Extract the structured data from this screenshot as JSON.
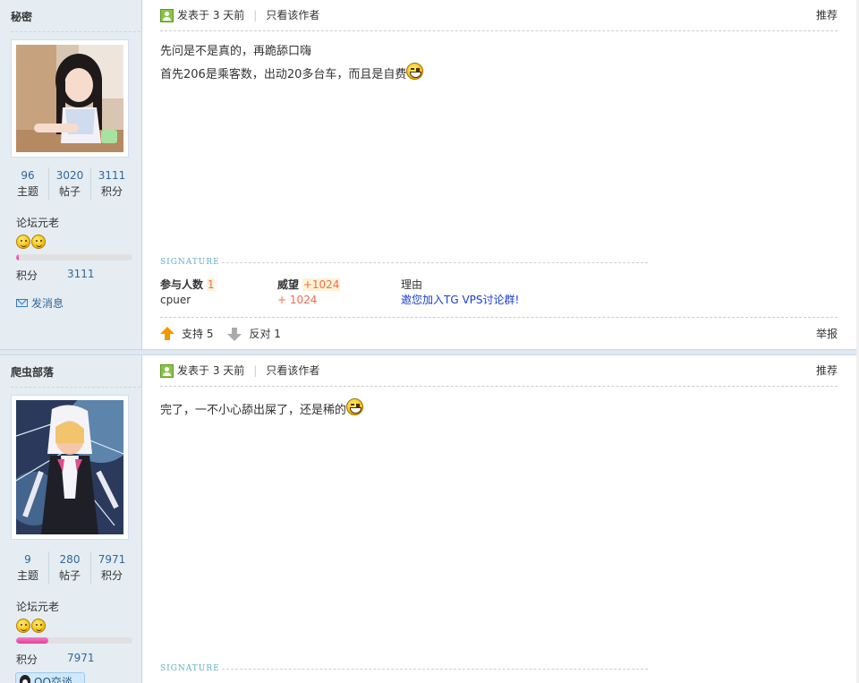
{
  "posts": [
    {
      "author": "秘密",
      "stats": [
        {
          "value": "96",
          "label": "主题"
        },
        {
          "value": "3020",
          "label": "帖子"
        },
        {
          "value": "3111",
          "label": "积分"
        }
      ],
      "rank": "论坛元老",
      "progress": 0.02,
      "score_label": "积分",
      "score_value": "3111",
      "send_message": "发消息",
      "posted": "发表于 3 天前",
      "only_author": "只看该作者",
      "recommend": "推荐",
      "content_lines": [
        "先问是不是真的，再跪舔口嗨",
        "首先206是乘客数，出动20多台车，而且是自费"
      ],
      "signature_label": "SIGNATURE",
      "rating": {
        "participants_label": "参与人数",
        "participants_count": "1",
        "prestige_label": "威望",
        "prestige_total": "+1024",
        "reason_label": "理由",
        "rater": "cpuer",
        "rater_prestige": "+ 1024",
        "reason_link": "邀您加入TG VPS讨论群!"
      },
      "support": "支持 5",
      "oppose": "反对 1",
      "report": "举报"
    },
    {
      "author": "爬虫部落",
      "stats": [
        {
          "value": "9",
          "label": "主题"
        },
        {
          "value": "280",
          "label": "帖子"
        },
        {
          "value": "7971",
          "label": "积分"
        }
      ],
      "rank": "论坛元老",
      "progress": 0.28,
      "score_label": "积分",
      "score_value": "7971",
      "qq_label": "QQ交谈",
      "posted": "发表于 3 天前",
      "only_author": "只看该作者",
      "recommend": "推荐",
      "content_lines": [
        "完了，一不小心舔出屎了，还是稀的"
      ],
      "signature_label": "SIGNATURE"
    }
  ],
  "colors": {
    "accent": "#336699",
    "sidebar_bg": "#e5edf2",
    "rating_orange": "#f26c4f",
    "link_blue": "#1a3fd4",
    "progress_pink": "#e0409c"
  }
}
